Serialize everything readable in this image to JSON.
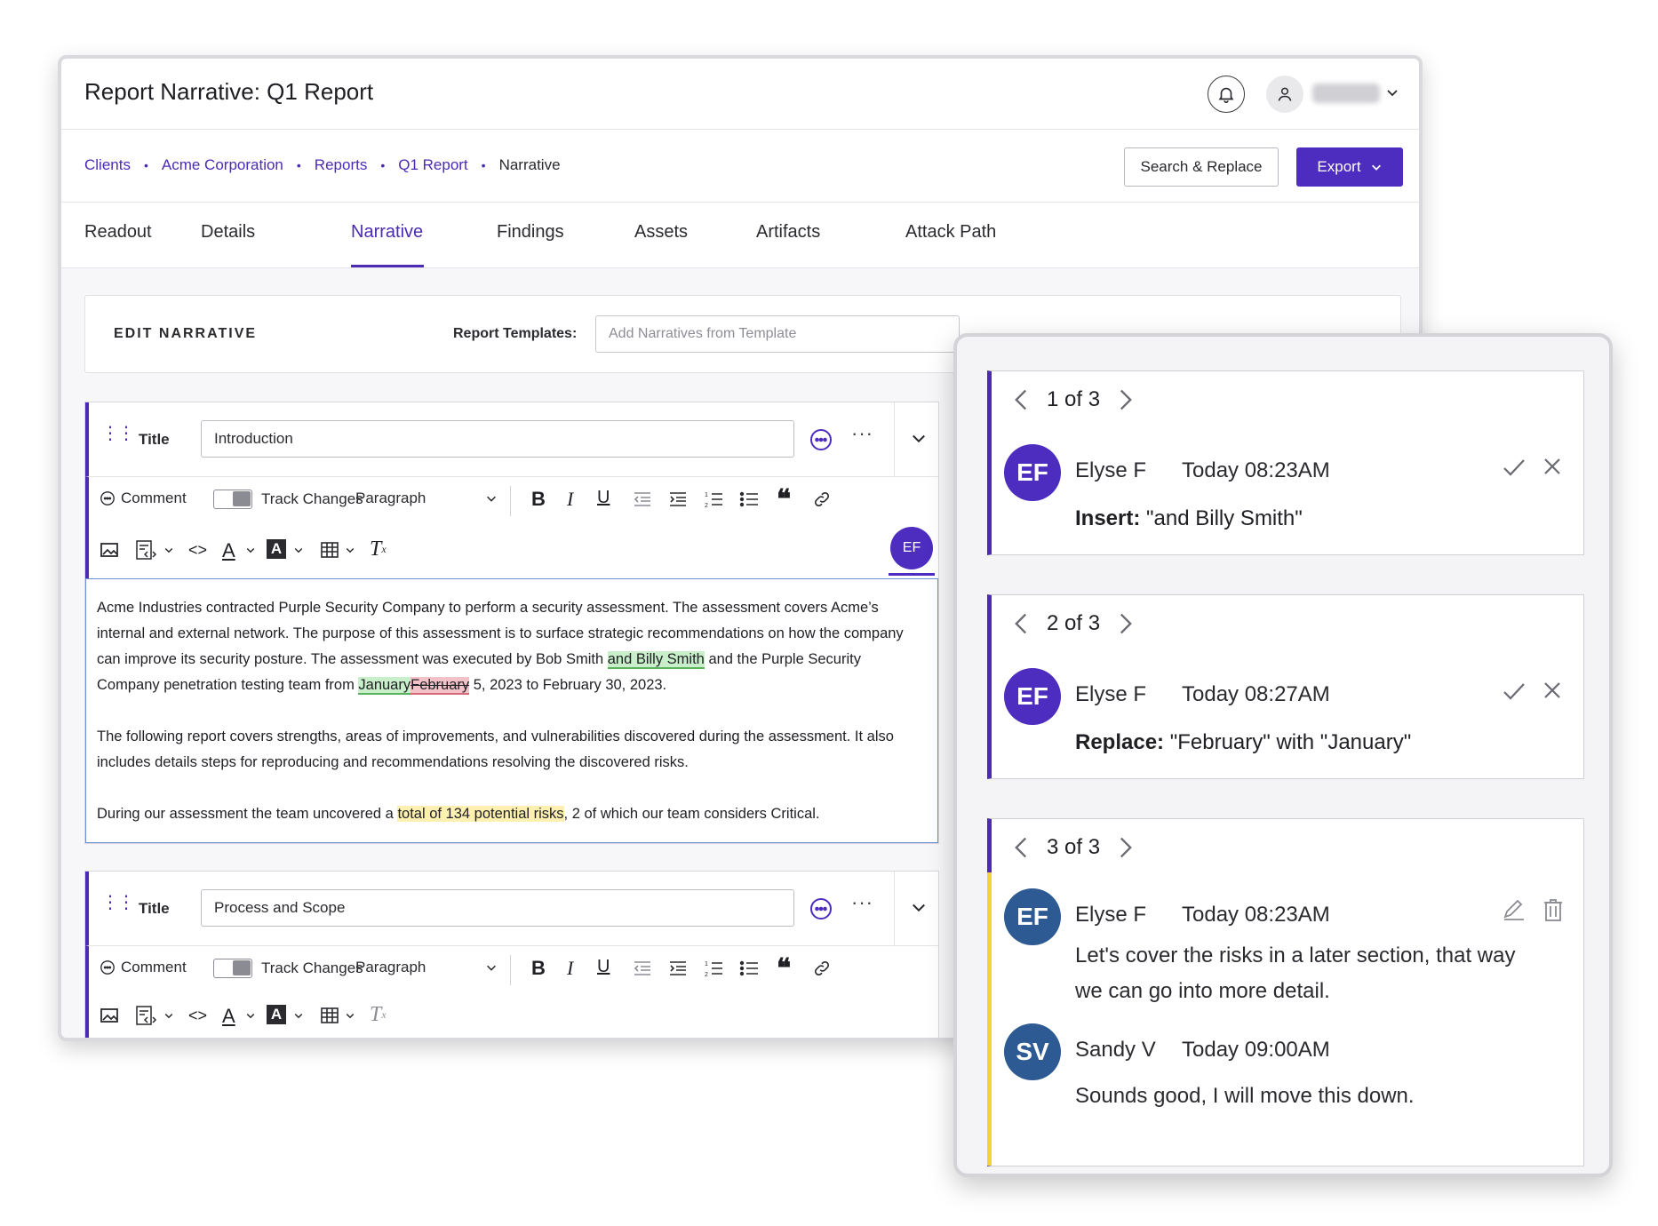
{
  "app": {
    "title": "Report Narrative: Q1 Report"
  },
  "breadcrumb": [
    {
      "label": "Clients",
      "link": true
    },
    {
      "label": "Acme Corporation",
      "link": true
    },
    {
      "label": "Reports",
      "link": true
    },
    {
      "label": "Q1 Report",
      "link": true
    },
    {
      "label": "Narrative",
      "link": false
    }
  ],
  "actions": {
    "search_replace": "Search & Replace",
    "export": "Export"
  },
  "tabs": [
    {
      "label": "Readout",
      "active": false
    },
    {
      "label": "Details",
      "active": false
    },
    {
      "label": "Narrative",
      "active": true
    },
    {
      "label": "Findings",
      "active": false
    },
    {
      "label": "Assets",
      "active": false
    },
    {
      "label": "Artifacts",
      "active": false
    },
    {
      "label": "Attack Path",
      "active": false
    }
  ],
  "edit_narrative": {
    "heading": "EDIT NARRATIVE",
    "templates_label": "Report Templates:",
    "templates_placeholder": "Add Narratives from Template"
  },
  "toolbar": {
    "comment": "Comment",
    "track_changes": "Track Changes",
    "paragraph": "Paragraph",
    "user_initials": "EF"
  },
  "sections": [
    {
      "title_label": "Title",
      "title_value": "Introduction",
      "body": {
        "p1_a": "Acme Industries contracted Purple Security Company to perform a security assessment. The assessment covers Acme’s internal and external network. The purpose of this assessment is to surface strategic recommendations on how the company can improve its security posture. The assessment was executed by Bob Smith ",
        "p1_ins": "and Billy Smith",
        "p1_b": " and the Purple Security Company penetration testing team from ",
        "p1_ins2": "January",
        "p1_del": "February",
        "p1_c": " 5, 2023 to February 30, 2023.",
        "p2": "The following report covers strengths, areas of improvements, and vulnerabilities discovered during the assessment. It also includes details steps for reproducing and recommendations resolving the discovered risks.",
        "p3_a": "During our assessment the team uncovered a ",
        "p3_hl": "total of 134 potential risks",
        "p3_b": ", 2 of which our team considers Critical."
      }
    },
    {
      "title_label": "Title",
      "title_value": "Process and Scope"
    }
  ],
  "panel": {
    "cards": [
      {
        "count": "1 of 3",
        "initials": "EF",
        "author": "Elyse F",
        "time": "Today 08:23AM",
        "kind": "Insert:",
        "text": "\"and Billy Smith\""
      },
      {
        "count": "2 of 3",
        "initials": "EF",
        "author": "Elyse F",
        "time": "Today 08:27AM",
        "kind": "Replace:",
        "text": "\"February\" with \"January\""
      },
      {
        "count": "3 of 3",
        "comments": [
          {
            "initials": "EF",
            "author": "Elyse F",
            "time": "Today 08:23AM",
            "text": "Let's cover the risks in a later section, that way we can go into more detail."
          },
          {
            "initials": "SV",
            "author": "Sandy V",
            "time": "Today 09:00AM",
            "text": "Sounds good, I will move this down."
          }
        ]
      }
    ]
  },
  "colors": {
    "brand": "#4d2dbf",
    "insert": "#c8efc9",
    "delete": "#f3c2c8",
    "highlight": "#fdf0b0",
    "comment_bar": "#f1d43a",
    "avatar_blue": "#2e5a93"
  }
}
